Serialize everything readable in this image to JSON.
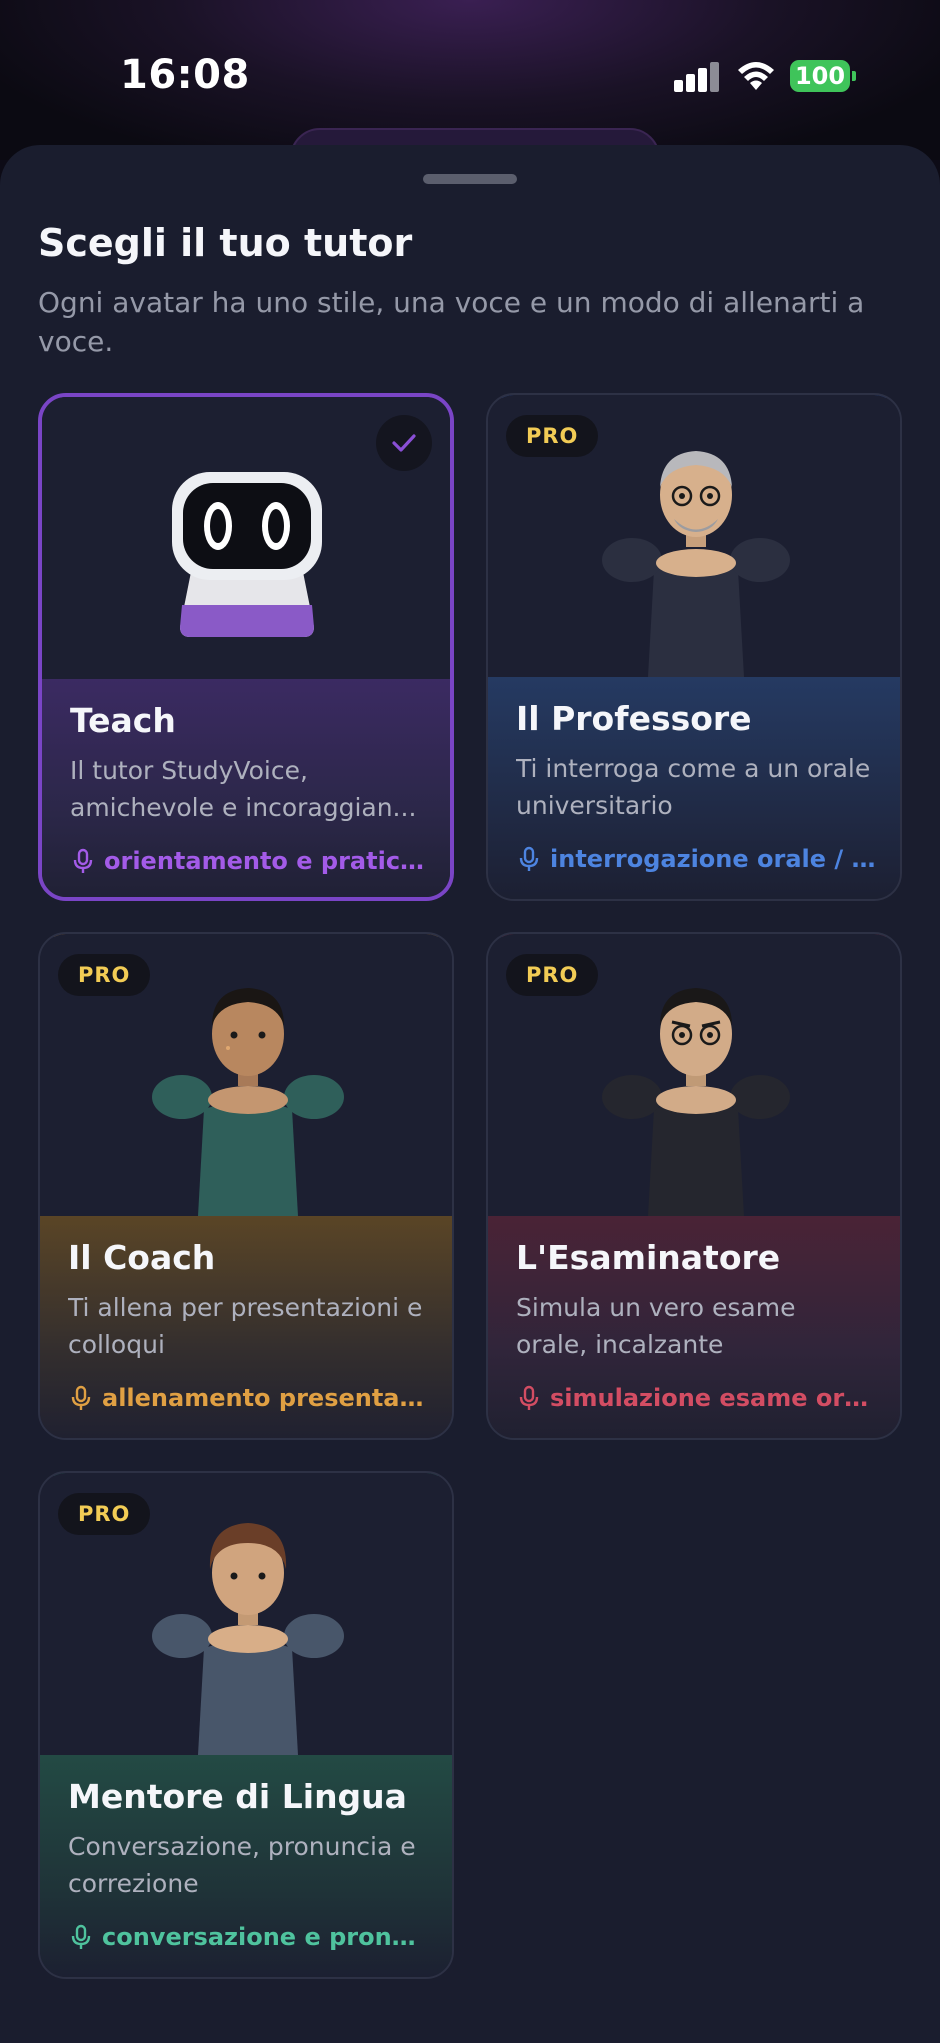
{
  "status_bar": {
    "time": "16:08",
    "battery": "100"
  },
  "sheet": {
    "title": "Scegli il tuo tutor",
    "subtitle": "Ogni avatar ha uno stile, una voce e un modo di allenarti a voce."
  },
  "tutors": [
    {
      "name": "Teach",
      "description": "Il tutor StudyVoice, amichevole e incoraggian...",
      "tag": "orientamento e pratica ...",
      "pro": "",
      "selected": true,
      "accent": "#8a4fd6",
      "tag_color": "#a35be8",
      "avatar": "robot-avatar"
    },
    {
      "name": "Il Professore",
      "description": "Ti interroga come a un orale universitario",
      "tag": "interrogazione orale / si...",
      "pro": "PRO",
      "selected": false,
      "accent": "#3a6fd0",
      "tag_color": "#4d84e0",
      "avatar": "professor-avatar"
    },
    {
      "name": "Il Coach",
      "description": "Ti allena per presentazioni e colloqui",
      "tag": "allenamento presentazi...",
      "pro": "PRO",
      "selected": false,
      "accent": "#c08a3e",
      "tag_color": "#e0a043",
      "avatar": "coach-avatar"
    },
    {
      "name": "L'Esaminatore",
      "description": "Simula un vero esame orale, incalzante",
      "tag": "simulazione esame oral...",
      "pro": "PRO",
      "selected": false,
      "accent": "#a83a4e",
      "tag_color": "#d34d63",
      "avatar": "examiner-avatar"
    },
    {
      "name": "Mentore di Lingua",
      "description": "Conversazione, pronuncia e correzione",
      "tag": "conversazione e pronun...",
      "pro": "PRO",
      "selected": false,
      "accent": "#2e8c74",
      "tag_color": "#4fc39e",
      "avatar": "language-mentor-avatar"
    }
  ]
}
